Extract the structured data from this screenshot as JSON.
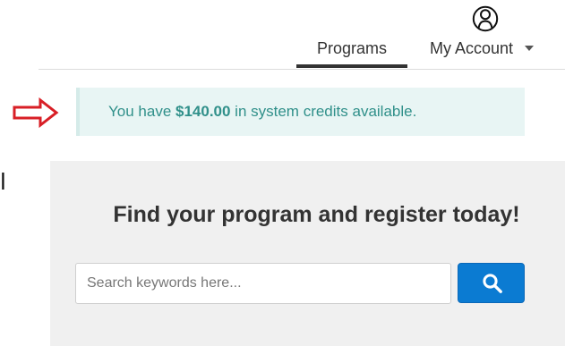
{
  "colors": {
    "accent": "#0b7bd2",
    "alert_background": "#e8f5f4",
    "alert_text": "#30908a",
    "arrow": "#d81f26"
  },
  "navigation": {
    "programs_label": "Programs",
    "account_label": "My Account",
    "account_icon": "user-outline-icon",
    "dropdown_icon": "caret-down-icon"
  },
  "credits": {
    "prefix": "You have ",
    "amount": "$140.00",
    "suffix": " in system credits available.",
    "annotation_icon": "right-arrow-icon"
  },
  "left_edge": {
    "partial_text": "ill"
  },
  "search": {
    "title": "Find your program and register today!",
    "placeholder": "Search keywords here...",
    "button_icon": "search-icon"
  }
}
